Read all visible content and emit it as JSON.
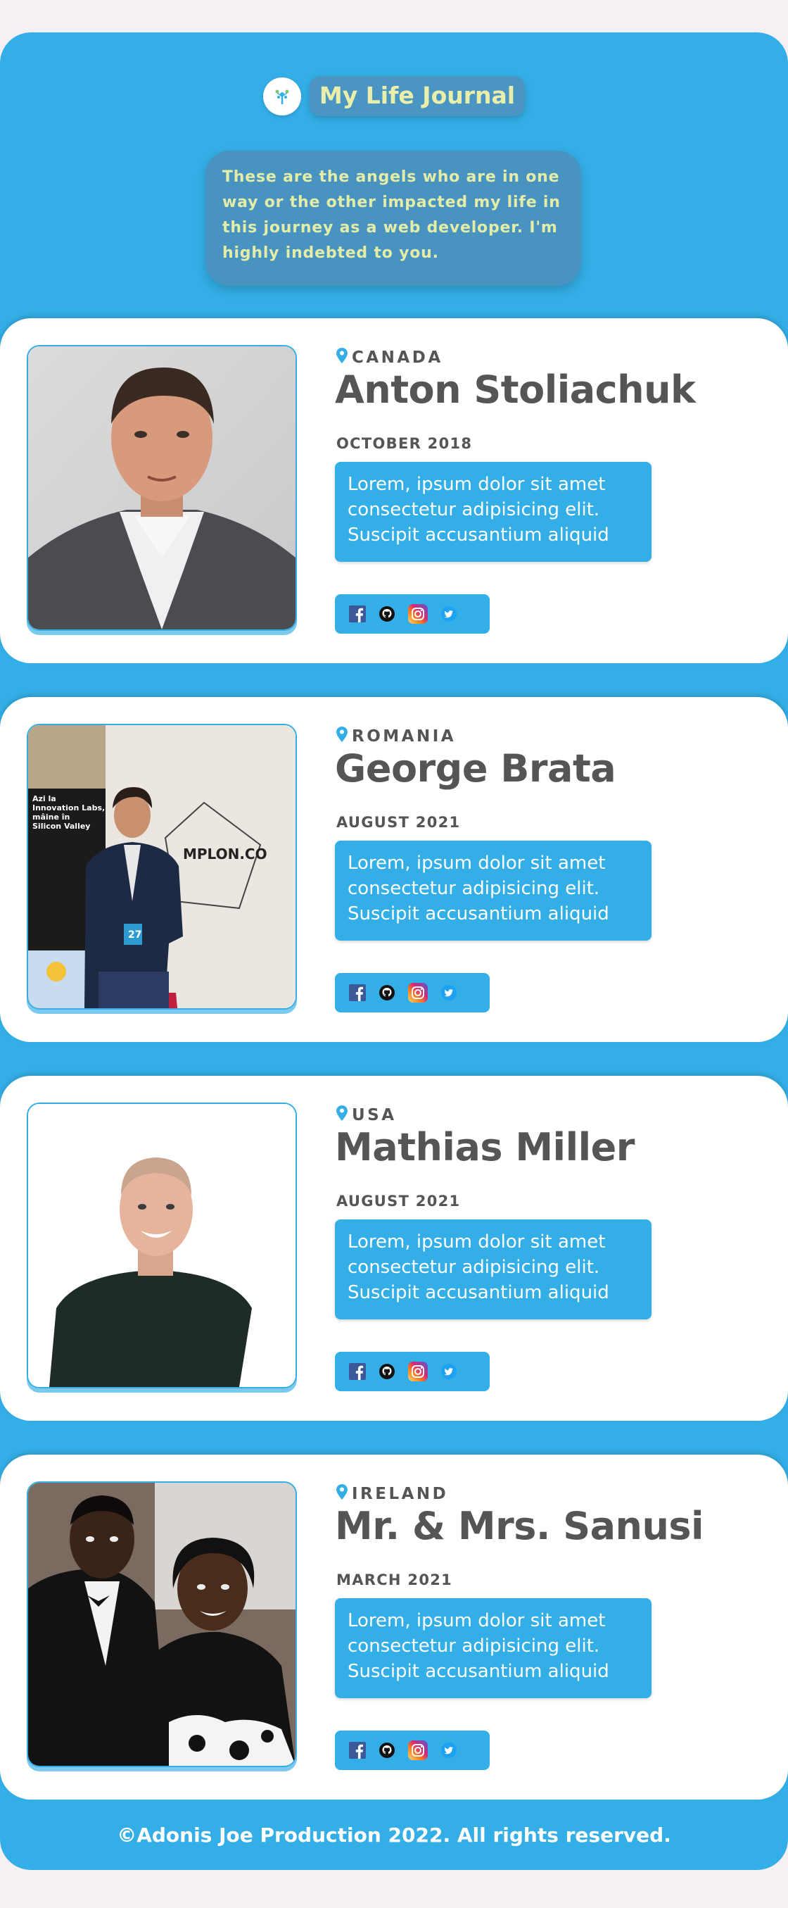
{
  "header": {
    "title": "My Life Journal",
    "intro": "These are the angels who are in one way or the other impacted my life in this journey as a web developer. I'm highly indebted to you."
  },
  "cards": [
    {
      "country": "CANADA",
      "name": "Anton Stoliachuk",
      "date": "OCTOBER 2018",
      "blurb": "Lorem, ipsum dolor sit amet consectetur adipisicing elit. Suscipit accusantium aliquid"
    },
    {
      "country": "ROMANIA",
      "name": "George Brata",
      "date": "AUGUST 2021",
      "blurb": "Lorem, ipsum dolor sit amet consectetur adipisicing elit. Suscipit accusantium aliquid",
      "banner": {
        "line1": "Azi la",
        "line2": "Innovation Labs,",
        "line3": "mâine în",
        "line4": "Silicon Valley",
        "brand": "MPLON.CO",
        "badge": "27"
      }
    },
    {
      "country": "USA",
      "name": "Mathias Miller",
      "date": "AUGUST 2021",
      "blurb": "Lorem, ipsum dolor sit amet consectetur adipisicing elit. Suscipit accusantium aliquid"
    },
    {
      "country": "IRELAND",
      "name": "Mr. & Mrs. Sanusi",
      "date": "MARCH 2021",
      "blurb": "Lorem, ipsum dolor sit amet consectetur adipisicing elit. Suscipit accusantium aliquid"
    }
  ],
  "icons": {
    "location": "location-pin-icon",
    "facebook": "facebook-icon",
    "github": "github-icon",
    "instagram": "instagram-icon",
    "twitter": "twitter-icon"
  },
  "colors": {
    "primary": "#33aee6",
    "pill": "#4b95c3",
    "pill_text": "#e9eeaa",
    "text_dark": "#555555"
  },
  "footer": {
    "text": "©Adonis Joe Production 2022. All rights reserved."
  }
}
